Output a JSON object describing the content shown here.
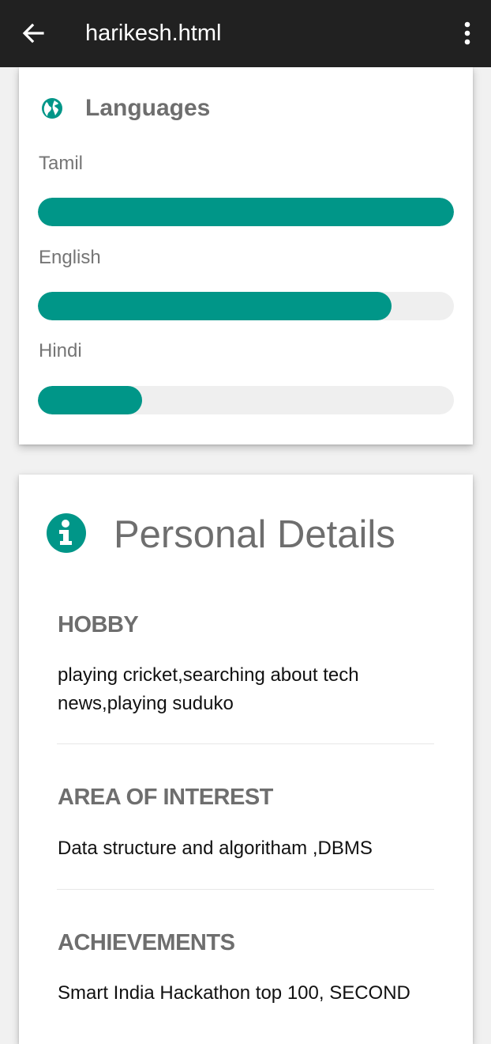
{
  "appbar": {
    "title": "harikesh.html",
    "back_icon": "arrow-left-icon",
    "menu_icon": "more-vertical-icon",
    "background": "#212121"
  },
  "languages_card": {
    "title": "Languages",
    "icon": "globe-icon",
    "accent": "#009688",
    "items": [
      {
        "label": "Tamil",
        "level": 1.0
      },
      {
        "label": "English",
        "level": 0.85
      },
      {
        "label": "Hindi",
        "level": 0.25
      }
    ]
  },
  "personal_card": {
    "title": "Personal Details",
    "icon": "info-icon",
    "sections": [
      {
        "heading": "HOBBY",
        "text": "playing cricket,searching about tech news,playing suduko"
      },
      {
        "heading": "AREA OF INTEREST",
        "text": "Data structure and algoritham ,DBMS"
      },
      {
        "heading": "ACHIEVEMENTS",
        "text": "Smart India Hackathon top 100, SECOND"
      }
    ]
  }
}
